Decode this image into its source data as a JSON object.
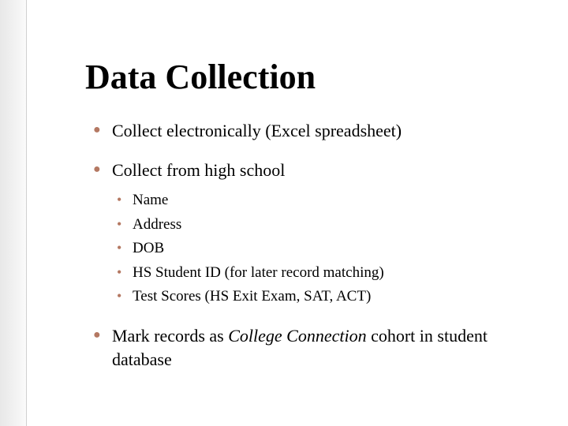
{
  "title": "Data Collection",
  "bullets": {
    "b1": "Collect electronically (Excel spreadsheet)",
    "b2": "Collect from high school",
    "b2_sub": {
      "s1": "Name",
      "s2": "Address",
      "s3": "DOB",
      "s4": "HS Student ID (for later record matching)",
      "s5": "Test Scores (HS Exit Exam, SAT, ACT)"
    },
    "b3_prefix": "Mark records as ",
    "b3_italic": "College Connection",
    "b3_suffix": " cohort in student database"
  }
}
